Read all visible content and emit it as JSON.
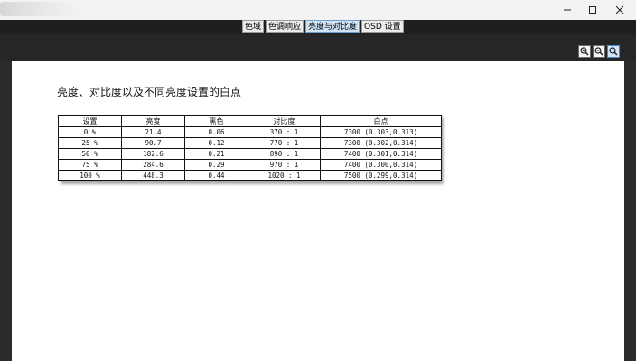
{
  "tabs": [
    {
      "label": "色域"
    },
    {
      "label": "色调响应"
    },
    {
      "label": "亮度与对比度"
    },
    {
      "label": "OSD 设置"
    }
  ],
  "active_tab": "亮度与对比度",
  "zoom_tools": [
    "zoom-in-icon",
    "zoom-out-icon",
    "zoom-fit-icon"
  ],
  "document": {
    "heading": "亮度、对比度以及不同亮度设置的白点",
    "table": {
      "headers": [
        "设置",
        "亮度",
        "黑色",
        "对比度",
        "白点"
      ],
      "rows": [
        [
          "0 %",
          "21.4",
          "0.06",
          "370 : 1",
          "7300 (0.303,0.313)"
        ],
        [
          "25 %",
          "90.7",
          "0.12",
          "770 : 1",
          "7300 (0.302,0.314)"
        ],
        [
          "50 %",
          "182.6",
          "0.21",
          "890 : 1",
          "7400 (0.301,0.314)"
        ],
        [
          "75 %",
          "284.6",
          "0.29",
          "970 : 1",
          "7400 (0.300,0.314)"
        ],
        [
          "100 %",
          "448.3",
          "0.44",
          "1020 : 1",
          "7500 (0.299,0.314)"
        ]
      ]
    }
  },
  "colors": {
    "active_tab_bg": "#cfe3f7",
    "page_bg": "#ffffff",
    "frame_dark": "#262626"
  }
}
